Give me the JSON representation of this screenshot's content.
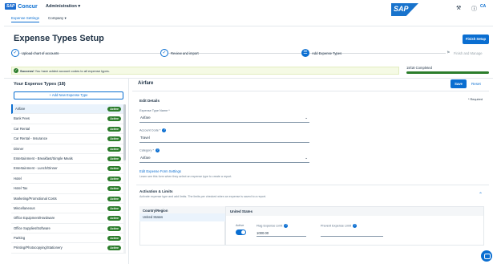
{
  "topbar": {
    "brand": "Concur",
    "brand_badge": "SAP",
    "module_menu": "Administration",
    "tabs": [
      "Expense Settings",
      "Company"
    ],
    "sap_logo": "SAP",
    "icons": [
      "tools-icon",
      "help-icon"
    ],
    "user_initials": "CA"
  },
  "page": {
    "title": "Expense Types Setup",
    "finish_button": "Finish Setup"
  },
  "steps": [
    {
      "label": "Upload chart of accounts",
      "state": "done"
    },
    {
      "label": "Review and import",
      "state": "done"
    },
    {
      "label": "Add Expense Types",
      "state": "current"
    },
    {
      "label": "Finish and Manage",
      "state": "pending"
    }
  ],
  "alert": {
    "strong": "Success!",
    "text": " You have added account codes to all expense types."
  },
  "progress": {
    "label": "18/18 Completed",
    "fraction": 1.0,
    "color": "#2b7d2b"
  },
  "sidebar": {
    "title": "Your Expense Types (18)",
    "add_button": "+ Add New Expense Type",
    "badge_label": "Active",
    "items": [
      "Airfare",
      "Bank Fees",
      "Car Rental",
      "Car Rental - Insurance",
      "Dinner",
      "Entertainment - Breakfast/Simple Meals",
      "Entertainment - Lunch/Dinner",
      "Hotel",
      "Hotel Tax",
      "Marketing/Promotional Costs",
      "Miscellaneous",
      "Office Equipment/Hardware",
      "Office Supplies/Software",
      "Parking",
      "Printing/Photocopying/Stationery"
    ],
    "selected_index": 0
  },
  "detail": {
    "title": "Airfare",
    "save_button": "Save",
    "reset_button": "Reset",
    "required_note": "* Required",
    "edit_section": "Edit Details",
    "name_label": "Expense Type Name *",
    "name_value": "Airfare",
    "account_label": "Account Code *",
    "account_value": "Travel",
    "category_label": "Category *",
    "category_value": "Airfare",
    "form_link": "Edit Expense Form Settings",
    "form_help": "Learn see this form when they select an expense type to create a report.",
    "limits_section": "Activation & Limits",
    "limits_help": "Activate expense type and add limits. The limits per checked when an expense is saved to a report.",
    "country_header": "Country/Region",
    "country_row": "United States",
    "us_header": "United States",
    "active_label": "Active",
    "active_on": true,
    "flag_limit_label": "Flag Expense Limit",
    "flag_limit_value": "1000.00",
    "prevent_limit_label": "Prevent Expense Limit",
    "prevent_limit_value": ""
  },
  "colors": {
    "accent": "#0a6ed1",
    "active_badge": "#2b7d2b",
    "success_bg": "#f5fae5"
  }
}
